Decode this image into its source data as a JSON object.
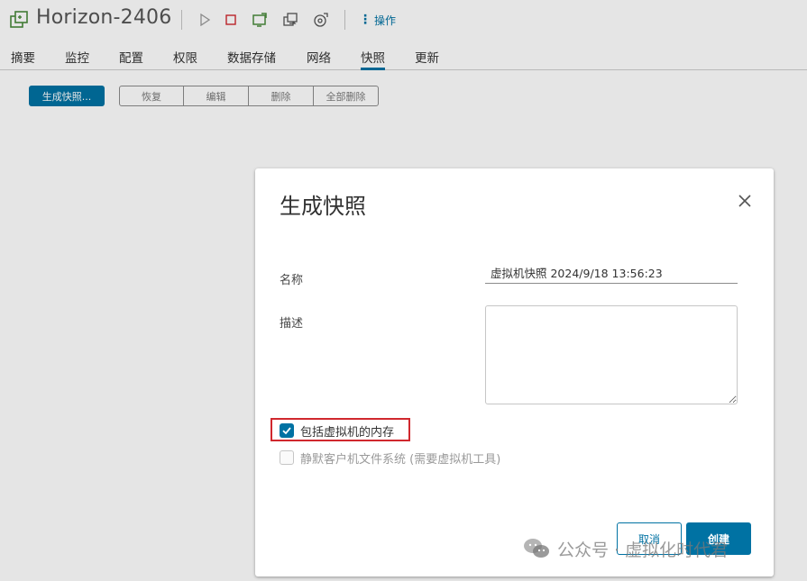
{
  "vm": {
    "title": "Horizon-2406",
    "actions_label": "操作"
  },
  "toolbar_icons": [
    "vm-icon",
    "power-on-icon",
    "power-off-icon",
    "console-icon",
    "migrate-icon",
    "snapshot-icon"
  ],
  "tabs": [
    {
      "label": "摘要"
    },
    {
      "label": "监控"
    },
    {
      "label": "配置"
    },
    {
      "label": "权限"
    },
    {
      "label": "数据存储"
    },
    {
      "label": "网络"
    },
    {
      "label": "快照",
      "active": true
    },
    {
      "label": "更新"
    }
  ],
  "snapshot_toolbar": {
    "take_snapshot": "生成快照...",
    "revert": "恢复",
    "edit": "编辑",
    "delete": "删除",
    "delete_all": "全部删除"
  },
  "dialog": {
    "title": "生成快照",
    "name_label": "名称",
    "name_value": "虚拟机快照 2024/9/18 13:56:23",
    "description_label": "描述",
    "description_value": "",
    "include_memory_label": "包括虚拟机的内存",
    "include_memory_checked": true,
    "quiesce_label": "静默客户机文件系统 (需要虚拟机工具)",
    "quiesce_checked": false,
    "quiesce_disabled": true,
    "cancel_label": "取消",
    "create_label": "创建"
  },
  "watermark": {
    "text": "公众号 · 虚拟化时代君"
  },
  "colors": {
    "accent": "#0072a3",
    "highlight_red": "#d0282e"
  }
}
